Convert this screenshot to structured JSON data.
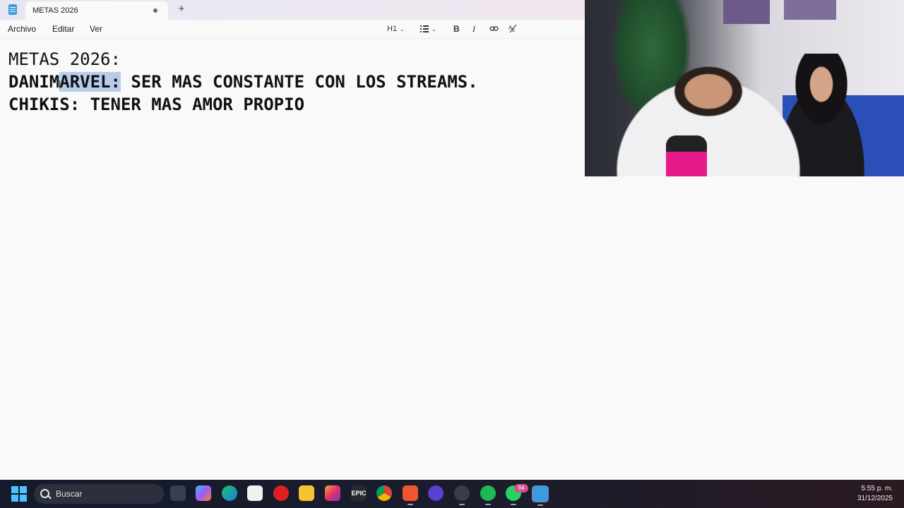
{
  "tab": {
    "title": "METAS 2026",
    "new_tab_symbol": "+"
  },
  "menu": {
    "archivo": "Archivo",
    "editar": "Editar",
    "ver": "Ver"
  },
  "toolbar": {
    "heading_label": "H1",
    "bold_label": "B",
    "italic_label": "I",
    "chevron": "⌄",
    "link_icon": "link-icon",
    "spellcheck_icon": "spellcheck-icon"
  },
  "document": {
    "line1": "METAS 2026:",
    "line2_before": "DANIM",
    "line2_selected": "ARVEL:",
    "line2_after": " SER MAS CONSTANTE CON LOS STREAMS.",
    "line3": "CHIKIS: TENER MAS AMOR PROPIO"
  },
  "taskbar": {
    "search_placeholder": "Buscar",
    "whatsapp_badge": "94",
    "epic_label": "EPIC",
    "time": "5:55 p. m.",
    "date": "31/12/2025"
  },
  "colors": {
    "selection": "#b7cde9",
    "taskbar_bg": "#141a2c",
    "start_accent": "#4cc2ff"
  }
}
